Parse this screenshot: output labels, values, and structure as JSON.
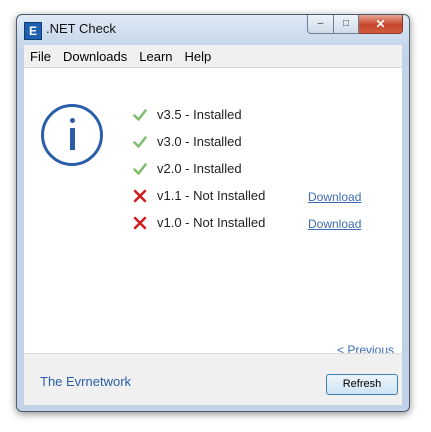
{
  "window": {
    "title": ".NET Check",
    "app_icon": "E",
    "buttons": {
      "minimize": "–",
      "maximize": "□",
      "close": "✕"
    }
  },
  "menu": [
    "File",
    "Downloads",
    "Learn",
    "Help"
  ],
  "info_icon": "info-icon",
  "versions": [
    {
      "text": "v3.5 - Installed",
      "installed": true
    },
    {
      "text": "v3.0 - Installed",
      "installed": true
    },
    {
      "text": "v2.0 - Installed",
      "installed": true
    },
    {
      "text": "v1.1 - Not Installed",
      "installed": false,
      "link": "Download"
    },
    {
      "text": "v1.0 - Not Installed",
      "installed": false,
      "link": "Download"
    }
  ],
  "previous_link": "< Previous",
  "footer": {
    "link": "The Evrnetwork",
    "refresh_button": "Refresh"
  },
  "colors": {
    "check": "#7dbb6a",
    "cross": "#d11f1f",
    "link": "#3b6cb3",
    "accent": "#2b5ea8"
  }
}
